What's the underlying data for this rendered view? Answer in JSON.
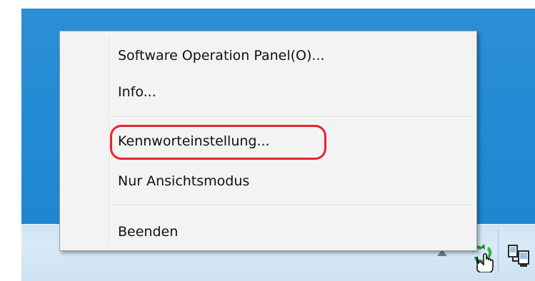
{
  "menu": {
    "items": [
      {
        "label": "Software Operation Panel(O)..."
      },
      {
        "label": "Info..."
      },
      {
        "label": "Kennworteinstellung..."
      },
      {
        "label": "Nur Ansichtsmodus"
      },
      {
        "label": "Beenden"
      }
    ]
  },
  "highlight": {
    "target": "Kennworteinstellung...",
    "color": "#e8232e"
  },
  "colors": {
    "desktop": "#238bd4",
    "taskbar": "#d8eaf7",
    "menu_background": "#f3f3f3"
  },
  "tray": {
    "icons": [
      "show-hidden-icons-arrow-icon",
      "scanner-icon",
      "network-icon"
    ]
  }
}
